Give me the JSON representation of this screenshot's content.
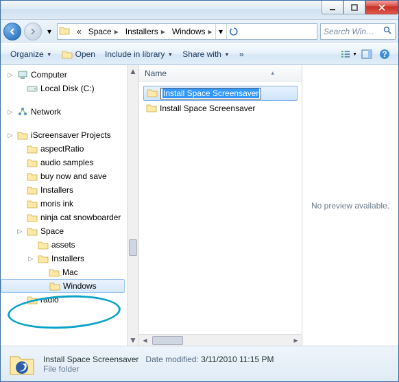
{
  "titlebar": {
    "min_tip": "Minimize",
    "max_tip": "Maximize",
    "close_tip": "Close"
  },
  "nav": {
    "back_tip": "Back",
    "fwd_tip": "Forward"
  },
  "breadcrumb": {
    "overflow": "«",
    "items": [
      "Space",
      "Installers",
      "Windows"
    ]
  },
  "search": {
    "placeholder": "Search Win…"
  },
  "toolbar": {
    "organize": "Organize",
    "open": "Open",
    "include": "Include in library",
    "share": "Share with",
    "overflow": "»"
  },
  "columns": {
    "name": "Name"
  },
  "tree": {
    "computer": "Computer",
    "local_disk": "Local Disk (C:)",
    "network": "Network",
    "projects": "iScreensaver Projects",
    "items": [
      "aspectRatio",
      "audio samples",
      "buy now and save",
      "Installers",
      "moris ink",
      "ninja cat snowboarder",
      "Space"
    ],
    "space_children": [
      "assets",
      "Installers"
    ],
    "installers_children": [
      "Mac",
      "Windows"
    ],
    "after_space": [
      "radio"
    ]
  },
  "files": {
    "rows": [
      "Install Space Screensaver",
      "Install Space Screensaver"
    ],
    "rename_text": "Install Space Screensaver"
  },
  "preview": {
    "text": "No preview available."
  },
  "status": {
    "name": "Install Space Screensaver",
    "type": "File folder",
    "modified_label": "Date modified:",
    "modified_value": "3/11/2010 11:15 PM"
  }
}
